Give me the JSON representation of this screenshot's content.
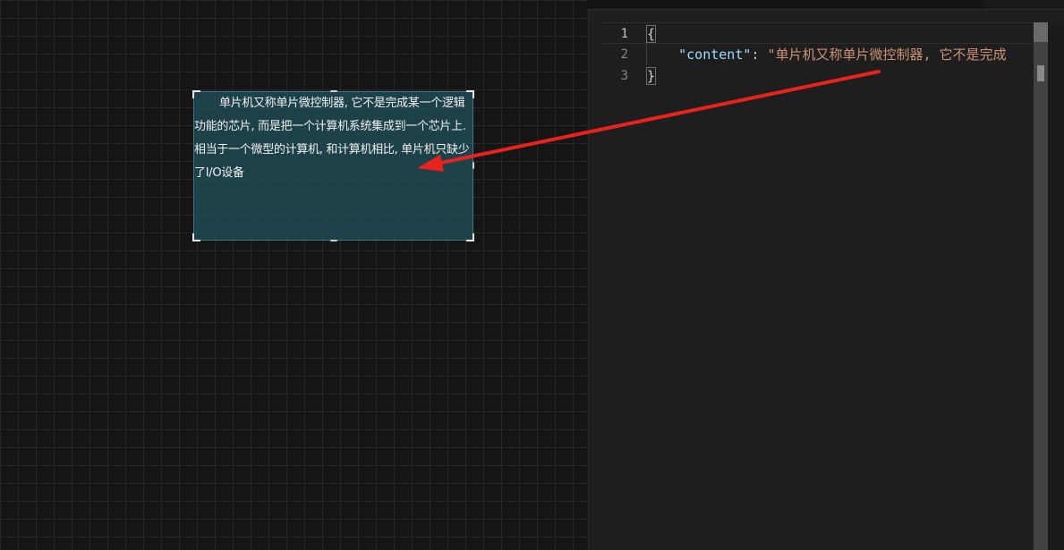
{
  "canvas": {
    "text_element": {
      "text": "单片机又称单片微控制器, 它不是完成某一个逻辑功能的芯片, 而是把一个计算机系统集成到一个芯片上. 相当于一个微型的计算机, 和计算机相比, 单片机只缺少了I/O设备"
    }
  },
  "editor": {
    "lines": [
      {
        "number": "1",
        "open_brace": "{"
      },
      {
        "number": "2",
        "key": "\"content\"",
        "colon": ": ",
        "value": "\"单片机又称单片微控制器, 它不是完成"
      },
      {
        "number": "3",
        "close_brace": "}"
      }
    ]
  },
  "annotation": {
    "arrow_color": "#e8231e"
  },
  "colors": {
    "canvas_bg": "#151515",
    "grid_line": "#262626",
    "text_box_bg": "#204e58",
    "editor_bg": "#1e1e1e",
    "json_key": "#9cdcfe",
    "json_string": "#ce9178",
    "line_number": "#858585"
  }
}
